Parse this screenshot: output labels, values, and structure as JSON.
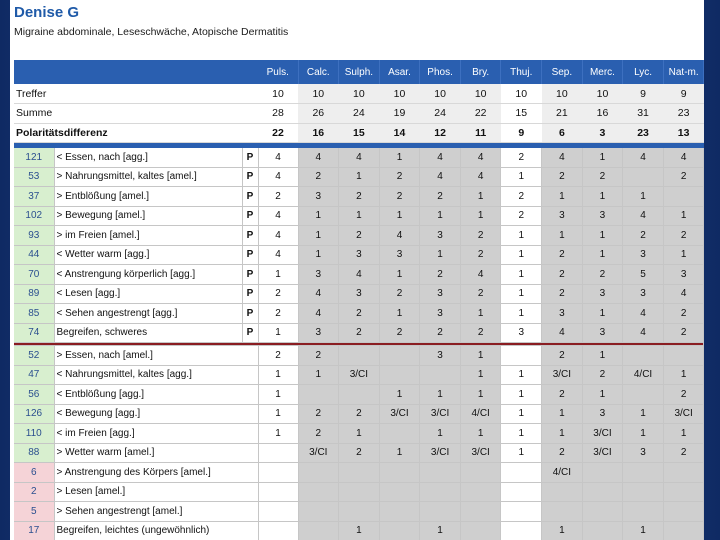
{
  "title": "Denise G",
  "subtitle": "Migraine abdominale, Leseschwäche, Atopische Dermatitis",
  "headers": [
    "Puls.",
    "Calc.",
    "Sulph.",
    "Asar.",
    "Phos.",
    "Bry.",
    "Thuj.",
    "Sep.",
    "Merc.",
    "Lyc.",
    "Nat-m."
  ],
  "summary": [
    {
      "label": "Treffer",
      "values": [
        "10",
        "10",
        "10",
        "10",
        "10",
        "10",
        "10",
        "10",
        "10",
        "9",
        "9"
      ],
      "bold": false
    },
    {
      "label": "Summe",
      "values": [
        "28",
        "26",
        "24",
        "19",
        "24",
        "22",
        "15",
        "21",
        "16",
        "31",
        "23"
      ],
      "bold": false
    },
    {
      "label": "Polaritätsdifferenz",
      "values": [
        "22",
        "16",
        "15",
        "14",
        "12",
        "11",
        "9",
        "6",
        "3",
        "23",
        "13"
      ],
      "bold": true
    }
  ],
  "upper_rows": [
    {
      "num": "121",
      "text": "< Essen, nach [agg.]",
      "flag": "P",
      "values": [
        "4",
        "4",
        "4",
        "1",
        "4",
        "4",
        "2",
        "4",
        "1",
        "4",
        "4"
      ]
    },
    {
      "num": "53",
      "text": "> Nahrungsmittel, kaltes [amel.]",
      "flag": "P",
      "values": [
        "4",
        "2",
        "1",
        "2",
        "4",
        "4",
        "1",
        "2",
        "2",
        "",
        "2"
      ]
    },
    {
      "num": "37",
      "text": "> Entblößung [amel.]",
      "flag": "P",
      "values": [
        "2",
        "3",
        "2",
        "2",
        "2",
        "1",
        "2",
        "1",
        "1",
        "1",
        ""
      ]
    },
    {
      "num": "102",
      "text": "> Bewegung [amel.]",
      "flag": "P",
      "values": [
        "4",
        "1",
        "1",
        "1",
        "1",
        "1",
        "2",
        "3",
        "3",
        "4",
        "1"
      ]
    },
    {
      "num": "93",
      "text": "> im Freien [amel.]",
      "flag": "P",
      "values": [
        "4",
        "1",
        "2",
        "4",
        "3",
        "2",
        "1",
        "1",
        "1",
        "2",
        "2"
      ]
    },
    {
      "num": "44",
      "text": "< Wetter warm [agg.]",
      "flag": "P",
      "values": [
        "4",
        "1",
        "3",
        "3",
        "1",
        "2",
        "1",
        "2",
        "1",
        "3",
        "1"
      ]
    },
    {
      "num": "70",
      "text": "< Anstrengung körperlich [agg.]",
      "flag": "P",
      "values": [
        "1",
        "3",
        "4",
        "1",
        "2",
        "4",
        "1",
        "2",
        "2",
        "5",
        "3"
      ]
    },
    {
      "num": "89",
      "text": "< Lesen [agg.]",
      "flag": "P",
      "values": [
        "2",
        "4",
        "3",
        "2",
        "3",
        "2",
        "1",
        "2",
        "3",
        "3",
        "4"
      ]
    },
    {
      "num": "85",
      "text": "< Sehen angestrengt [agg.]",
      "flag": "P",
      "values": [
        "2",
        "4",
        "2",
        "1",
        "3",
        "1",
        "1",
        "3",
        "1",
        "4",
        "2"
      ]
    },
    {
      "num": "74",
      "text": "Begreifen, schweres",
      "flag": "P",
      "values": [
        "1",
        "3",
        "2",
        "2",
        "2",
        "2",
        "3",
        "4",
        "3",
        "4",
        "2"
      ]
    }
  ],
  "lower_rows": [
    {
      "num": "52",
      "numtone": "g",
      "text": "> Essen, nach [amel.]",
      "values": [
        "2",
        "2",
        "",
        "",
        "3",
        "1",
        "",
        "2",
        "1",
        "",
        ""
      ]
    },
    {
      "num": "47",
      "numtone": "g",
      "text": "< Nahrungsmittel, kaltes [agg.]",
      "values": [
        "1",
        "1",
        "3/CI",
        "",
        "",
        "1",
        "1",
        "3/CI",
        "2",
        "4/CI",
        "1"
      ]
    },
    {
      "num": "56",
      "numtone": "g",
      "text": "< Entblößung [agg.]",
      "values": [
        "1",
        "",
        "",
        "1",
        "1",
        "1",
        "1",
        "2",
        "1",
        "",
        "2"
      ]
    },
    {
      "num": "126",
      "numtone": "g",
      "text": "< Bewegung [agg.]",
      "values": [
        "1",
        "2",
        "2",
        "3/CI",
        "3/CI",
        "4/CI",
        "1",
        "1",
        "3",
        "1",
        "3/CI"
      ]
    },
    {
      "num": "110",
      "numtone": "g",
      "text": "< im Freien [agg.]",
      "values": [
        "1",
        "2",
        "1",
        "",
        "1",
        "1",
        "1",
        "1",
        "3/CI",
        "1",
        "1"
      ]
    },
    {
      "num": "88",
      "numtone": "g",
      "text": "> Wetter warm [amel.]",
      "values": [
        "",
        "3/CI",
        "2",
        "1",
        "3/CI",
        "3/CI",
        "1",
        "2",
        "3/CI",
        "3",
        "2"
      ]
    },
    {
      "num": "6",
      "numtone": "p",
      "text": "> Anstrengung des Körpers [amel.]",
      "values": [
        "",
        "",
        "",
        "",
        "",
        "",
        "",
        "4/CI",
        "",
        "",
        ""
      ]
    },
    {
      "num": "2",
      "numtone": "p",
      "text": "> Lesen [amel.]",
      "values": [
        "",
        "",
        "",
        "",
        "",
        "",
        "",
        "",
        "",
        "",
        ""
      ]
    },
    {
      "num": "5",
      "numtone": "p",
      "text": "> Sehen angestrengt [amel.]",
      "values": [
        "",
        "",
        "",
        "",
        "",
        "",
        "",
        "",
        "",
        "",
        ""
      ]
    },
    {
      "num": "17",
      "numtone": "p",
      "text": "Begreifen, leichtes (ungewöhnlich)",
      "values": [
        "",
        "",
        "1",
        "",
        "1",
        "",
        "",
        "1",
        "",
        "1",
        ""
      ]
    }
  ],
  "colors": {
    "header_blue": "#2a5fb0",
    "title_blue": "#1f5aa8",
    "separator_red": "#8a1d22",
    "green_cell": "#d8efcf",
    "pink_cell": "#f5d3d7",
    "grey_cell": "#cfcfcf"
  }
}
